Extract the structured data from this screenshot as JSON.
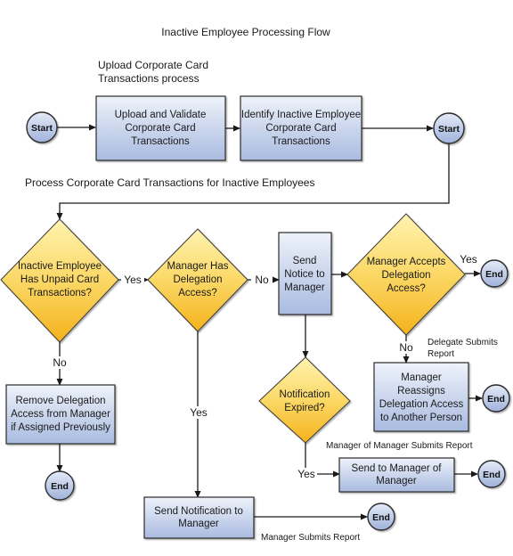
{
  "title": "Inactive Employee Processing Flow",
  "sections": {
    "upload": "Upload Corporate Card\nTransactions process",
    "process": "Process Corporate Card Transactions for Inactive Employees"
  },
  "nodes": {
    "start1": "Start",
    "upload_validate": "Upload and Validate\nCorporate Card\nTransactions",
    "identify_inactive": "Identify Inactive Employee\nCorporate Card\nTransactions",
    "start2": "Start",
    "has_unpaid": "Inactive Employee\nHas Unpaid Card\nTransactions?",
    "has_delegation": "Manager Has\nDelegation\nAccess?",
    "send_notice": "Send\nNotice to\nManager",
    "accepts_delegation": "Manager Accepts\nDelegation\nAccess?",
    "end_accept": "End",
    "remove_delegation": "Remove Delegation\nAccess from Manager\nif Assigned Previously",
    "end_remove": "End",
    "notification_expired": "Notification\nExpired?",
    "reassigns": "Manager\nReassigns\nDelegation Access\nto Another Person",
    "end_reassign": "End",
    "send_mom": "Send to Manager of\nManager",
    "end_mom": "End",
    "send_notification": "Send Notification to\nManager",
    "end_notification": "End"
  },
  "edge_labels": {
    "yes_unpaid": "Yes",
    "no_unpaid": "No",
    "no_delegation": "No",
    "yes_delegation": "Yes",
    "yes_accepts": "Yes",
    "no_accepts": "No",
    "yes_expired": "Yes"
  },
  "annotations": {
    "delegate_submits": "Delegate Submits\nReport",
    "mom_submits": "Manager of Manager Submits Report",
    "manager_submits": "Manager Submits Report"
  },
  "colors": {
    "box_top": "#eef2fa",
    "box_bottom": "#a9bbe0",
    "diamond_top": "#fff3b0",
    "diamond_bottom": "#f5b21c",
    "terminal_top": "#e4ebf8",
    "terminal_bottom": "#9fb2da"
  }
}
